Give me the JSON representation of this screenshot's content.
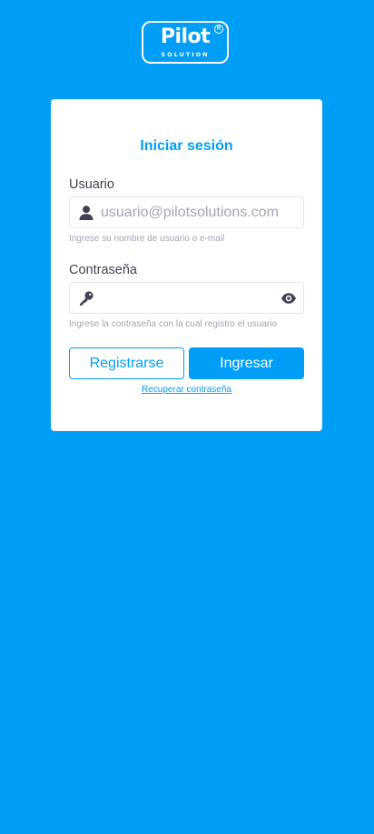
{
  "logo": {
    "word": "Pilot",
    "sub": "SOLUTION",
    "registered": "R"
  },
  "card": {
    "title": "Iniciar sesión"
  },
  "username": {
    "label": "Usuario",
    "placeholder": "usuario@pilotsolutions.com",
    "value": "",
    "help": "Ingrese su nombre de usuario o e-mail",
    "icon": "user-icon"
  },
  "password": {
    "label": "Contraseña",
    "value": "",
    "help": "Ingrese la contraseña con la cual registro el usuario",
    "icon": "key-icon",
    "toggle_icon": "eye-icon"
  },
  "actions": {
    "register_label": "Registrarse",
    "login_label": "Ingresar",
    "recover_label": "Recuperar contraseña"
  },
  "colors": {
    "background": "#009EF7",
    "accent": "#009EF7",
    "card": "#FFFFFF",
    "label_text": "#3F4254",
    "muted_text": "#A1A5B7"
  }
}
